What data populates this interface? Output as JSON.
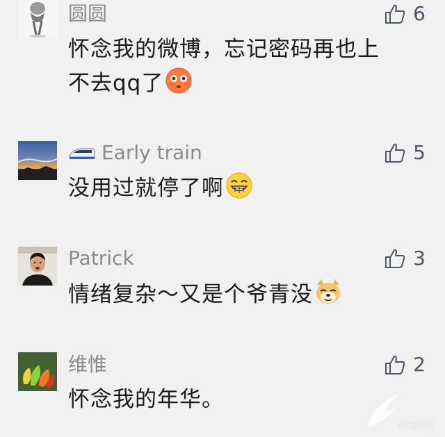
{
  "comments": [
    {
      "name": "圆圆",
      "likes": "6",
      "lines": [
        "怀念我的微博，忘记密码再也上",
        "不去qq了"
      ],
      "emoji": "flushed-face-emoji",
      "avatar": "figure-sketch-avatar"
    },
    {
      "name": "Early train",
      "name_icon": "bullet-train-icon",
      "likes": "5",
      "lines": [
        "没用过就停了啊"
      ],
      "emoji": "grinning-face-emoji",
      "avatar": "sunset-landscape-avatar"
    },
    {
      "name": "Patrick",
      "likes": "3",
      "lines": [
        "情绪复杂～又是个爷青没"
      ],
      "emoji": "doge-emoji",
      "avatar": "man-portrait-avatar"
    },
    {
      "name": "维惟",
      "likes": "2",
      "lines": [
        "怀念我的年华。"
      ],
      "avatar": "colorful-leaves-avatar"
    }
  ],
  "watermark": {
    "text": "闪电新闻"
  },
  "colors": {
    "background": "#f1f1f1",
    "name": "#8a8a8a",
    "text": "#1a1a1a",
    "like": "#4b5563"
  }
}
